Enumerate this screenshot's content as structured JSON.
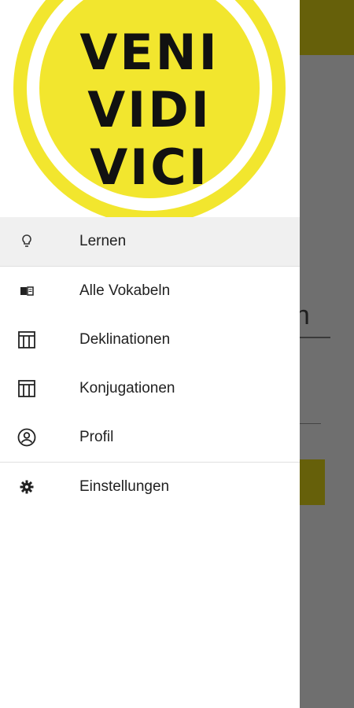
{
  "logo": {
    "lines": [
      "VENI",
      "VIDI",
      "VICI"
    ]
  },
  "drawer": {
    "items": [
      {
        "label": "Lernen",
        "icon": "lightbulb-icon"
      },
      {
        "label": "Alle Vokabeln",
        "icon": "book-icon"
      },
      {
        "label": "Deklinationen",
        "icon": "table-icon"
      },
      {
        "label": "Konjugationen",
        "icon": "table-icon"
      },
      {
        "label": "Profil",
        "icon": "account-circle-icon"
      },
      {
        "label": "Einstellungen",
        "icon": "gear-icon"
      }
    ]
  },
  "background": {
    "text1": "n",
    "text2": "on"
  },
  "colors": {
    "logo_yellow": "#f2e62e",
    "appbar_dimmed": "#66600a",
    "scrim": "#6f6f6f"
  }
}
